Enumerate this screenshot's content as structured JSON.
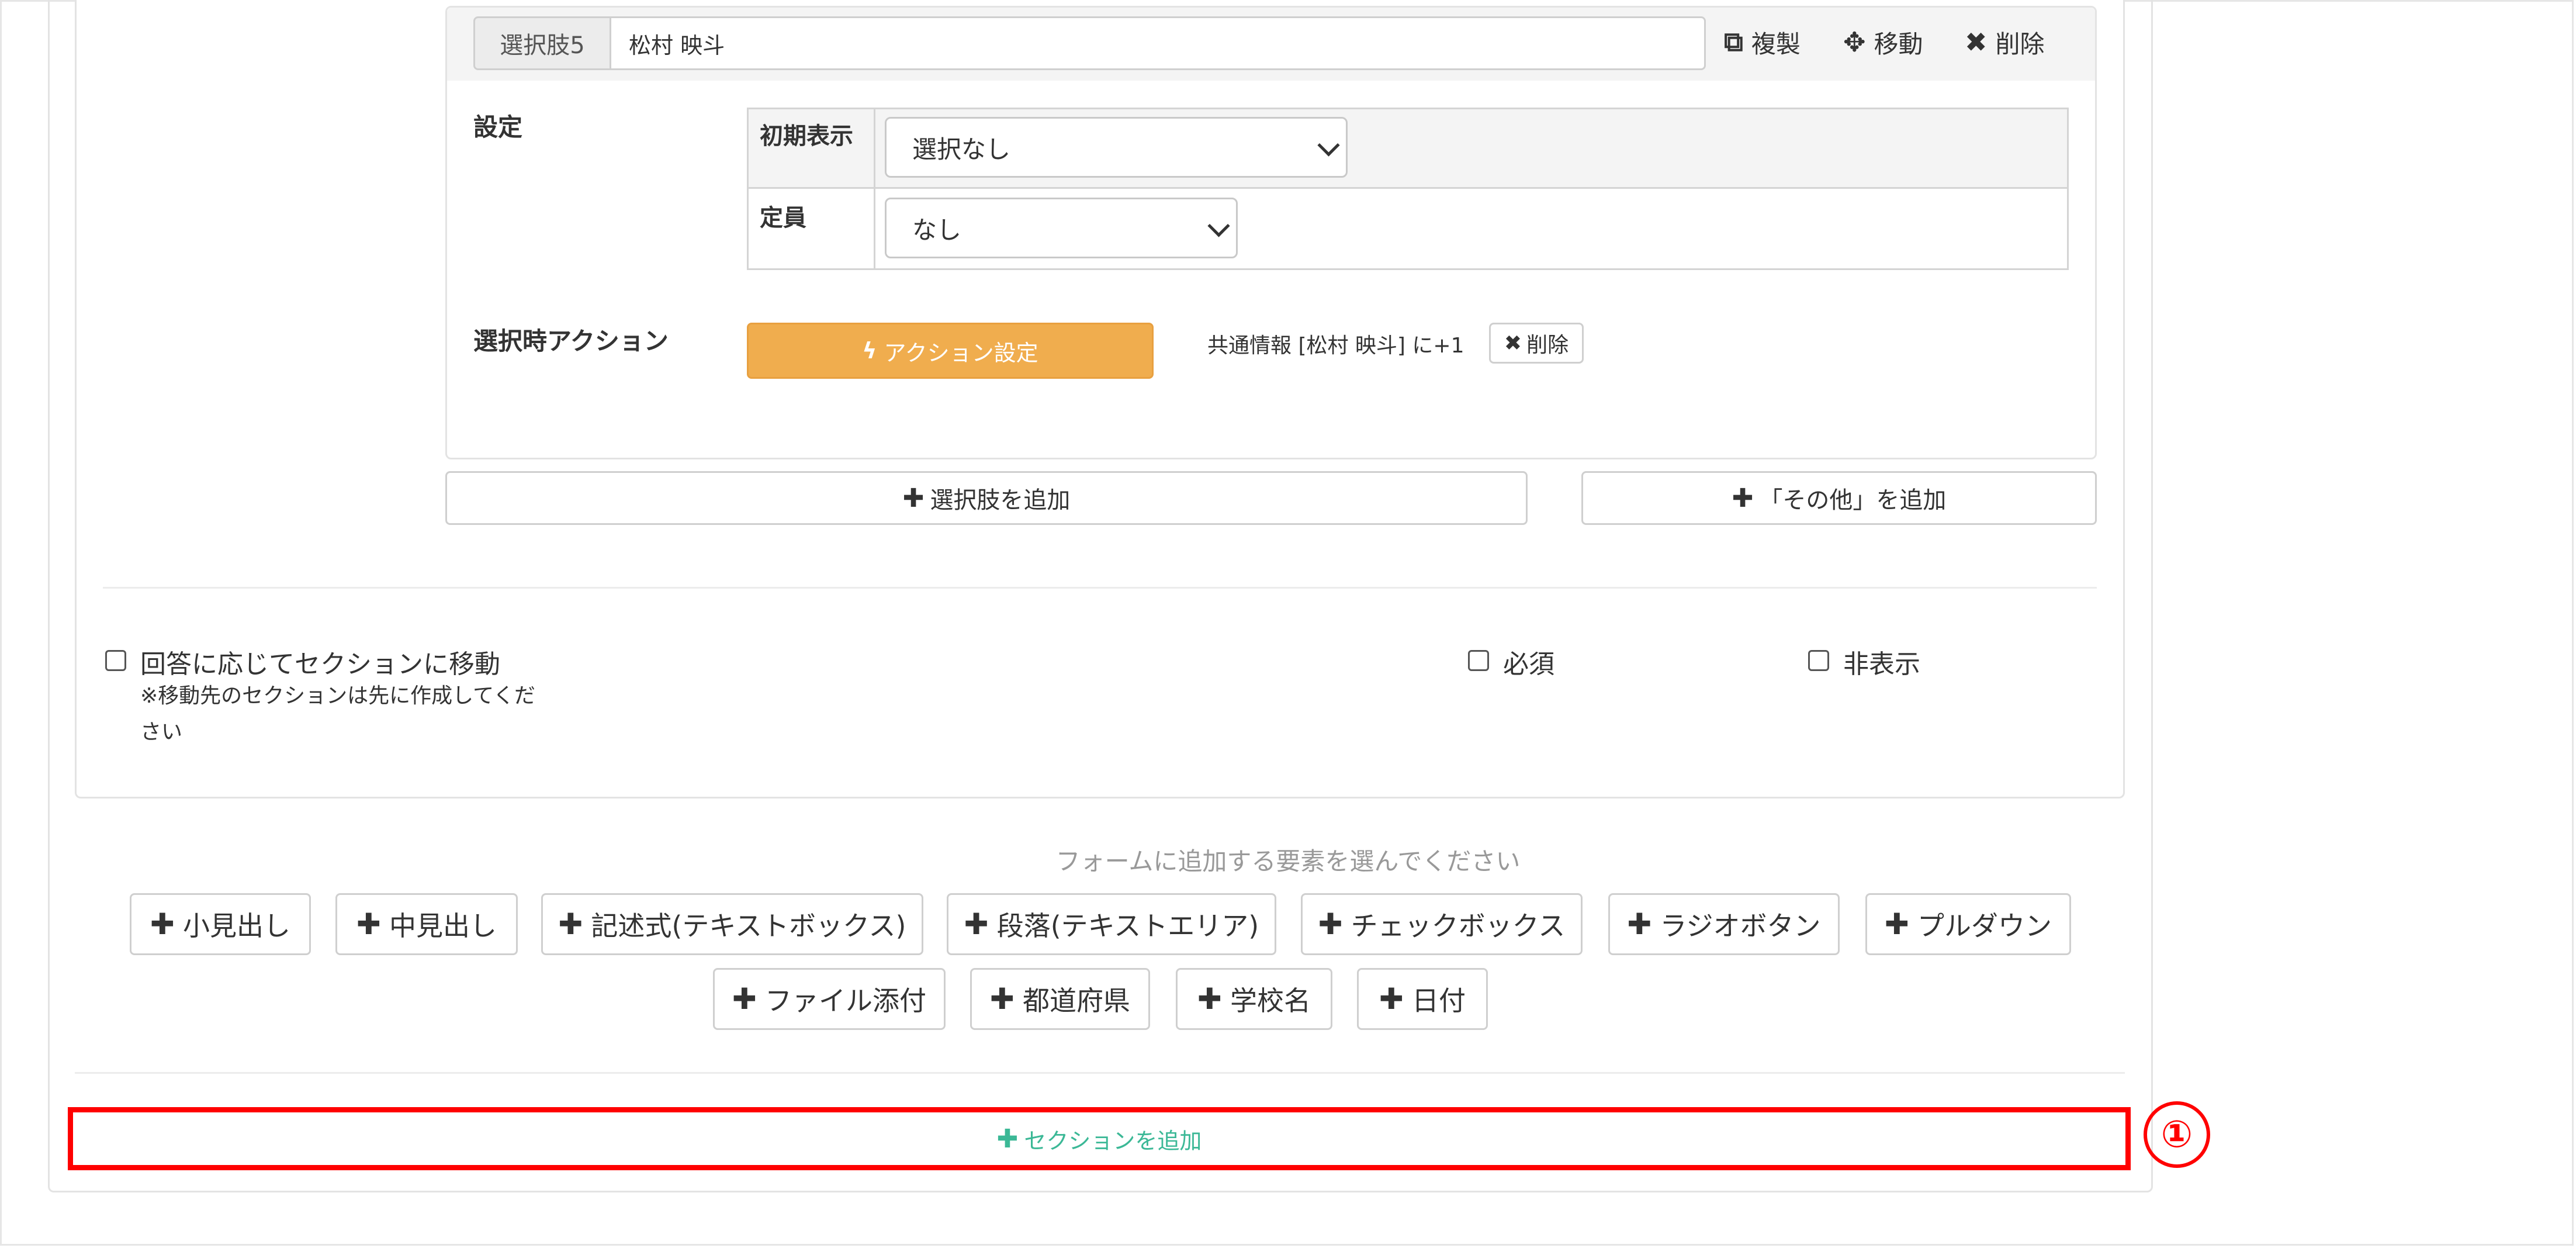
{
  "choice": {
    "label": "選択肢5",
    "value": "松村 映斗",
    "duplicate_label": "複製",
    "move_label": "移動",
    "delete_label": "削除"
  },
  "settings": {
    "label": "設定",
    "initial_display_label": "初期表示",
    "initial_display_value": "選択なし",
    "capacity_label": "定員",
    "capacity_value": "なし"
  },
  "action": {
    "label": "選択時アクション",
    "button_label": "アクション設定",
    "summary": "共通情報 [松村 映斗] に+1",
    "delete_label": "削除"
  },
  "add_choice_label": "選択肢を追加",
  "add_other_label": "「その他」を追加",
  "options": {
    "section_jump_label": "回答に応じてセクションに移動",
    "section_jump_note_line1": "※移動先のセクションは先に作成してくだ",
    "section_jump_note_line2": "さい",
    "required_label": "必須",
    "hidden_label": "非表示"
  },
  "elements": {
    "prompt": "フォームに追加する要素を選んでください",
    "buttons": [
      "小見出し",
      "中見出し",
      "記述式(テキストボックス)",
      "段落(テキストエリア)",
      "チェックボックス",
      "ラジオボタン",
      "プルダウン",
      "ファイル添付",
      "都道府県",
      "学校名",
      "日付"
    ]
  },
  "add_section_label": "セクションを追加",
  "marker_label": "①",
  "icons": {
    "plus": "+",
    "plus_bold": "✚",
    "times": "✖",
    "bolt": "ϟ",
    "copy": "⧉",
    "move": "✥"
  },
  "colors": {
    "action_orange": "#f0ad4e",
    "add_section_green": "#3bb896",
    "highlight_red": "#ff0000"
  }
}
